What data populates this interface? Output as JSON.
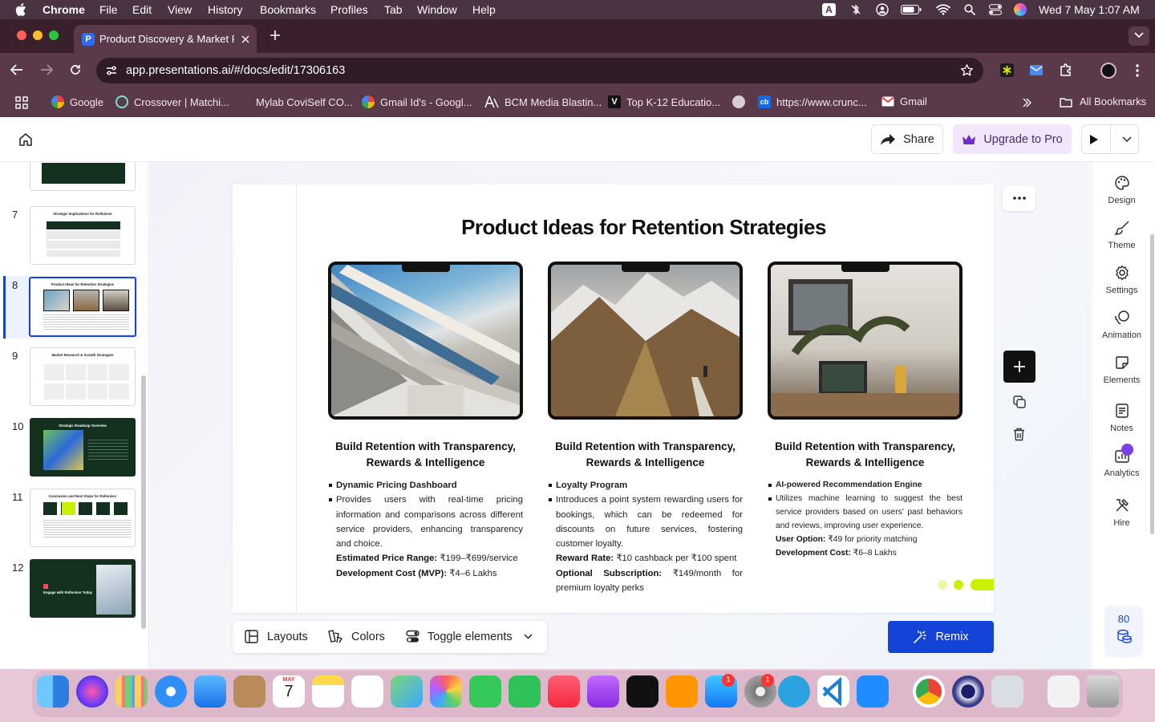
{
  "menubar": {
    "app": "Chrome",
    "items": [
      "File",
      "Edit",
      "View",
      "History",
      "Bookmarks",
      "Profiles",
      "Tab",
      "Window",
      "Help"
    ],
    "clock": "Wed 7 May  1:07 AM",
    "input_badge": "A"
  },
  "browser": {
    "tab_title": "Product Discovery & Market F",
    "url": "app.presentations.ai/#/docs/edit/17306163",
    "bookmarks": [
      "Google",
      "Crossover | Matchi...",
      "Mylab CoviSelf CO...",
      "Gmail Id's - Googl...",
      "BCM Media Blastin...",
      "Top K-12 Educatio...",
      "https://www.crunc...",
      "Gmail"
    ],
    "bookmark_badges": [
      "V",
      "cb"
    ],
    "all_bookmarks": "All Bookmarks"
  },
  "header": {
    "share": "Share",
    "upgrade": "Upgrade to Pro"
  },
  "thumbnails": {
    "items": [
      {
        "num": "7",
        "title": "Strategic Implications for Rolloniver"
      },
      {
        "num": "8",
        "title": "Product Ideas for Retention Strategies"
      },
      {
        "num": "9",
        "title": "Market Research & Growth Strategies"
      },
      {
        "num": "10",
        "title": "Strategic Roadmap Overview"
      },
      {
        "num": "11",
        "title": "Conclusion and Next Steps for Rolloniver"
      },
      {
        "num": "12",
        "title": "Engage with Rolloniver Today"
      }
    ],
    "selected": "8"
  },
  "slide": {
    "title": "Product Ideas for Retention Strategies",
    "cards": [
      {
        "heading_line1": "Build Retention with Transparency,",
        "heading_line2": "Rewards & Intelligence",
        "bullet1": "Dynamic Pricing Dashboard",
        "bullet2": "Provides users with real-time pricing information and comparisons across different service providers, enhancing transparency and choice.",
        "line1_label": "Estimated Price Range:",
        "line1_value": " ₹199–₹699/service",
        "line2_label": "Development Cost (MVP):",
        "line2_value": " ₹4–6 Lakhs"
      },
      {
        "heading_line1": "Build Retention with Transparency,",
        "heading_line2": "Rewards & Intelligence",
        "bullet1": "Loyalty Program",
        "bullet2": "Introduces a point system rewarding users for bookings, which can be redeemed for discounts on future services, fostering customer loyalty.",
        "line1_label": "Reward Rate:",
        "line1_value": " ₹10 cashback per ₹100 spent",
        "line2_label": "Optional Subscription:",
        "line2_value": " ₹149/month for premium loyalty perks"
      },
      {
        "heading_line1": "Build Retention with Transparency,",
        "heading_line2": "Rewards & Intelligence",
        "bullet1": "AI-powered Recommendation Engine",
        "bullet2": "Utilizes machine learning to suggest the best service providers based on users' past behaviors and reviews, improving user experience.",
        "line1_label": "User Option:",
        "line1_value": " ₹49 for priority matching",
        "line2_label": "Development Cost:",
        "line2_value": " ₹6–8 Lakhs"
      }
    ]
  },
  "rightrail": {
    "items": [
      "Design",
      "Theme",
      "Settings",
      "Animation",
      "Elements",
      "Notes",
      "Analytics",
      "Hire"
    ],
    "credits": "80"
  },
  "bottombar": {
    "layouts": "Layouts",
    "colors": "Colors",
    "toggle": "Toggle elements",
    "remix": "Remix"
  },
  "dock": {
    "calendar_month": "MAY",
    "calendar_day": "7",
    "appstore_badge": "1",
    "settings_badge": "1"
  },
  "colors": {
    "accent_blue": "#1443d8",
    "slide_dark_green": "#14301f",
    "lime_accent": "#c8f000",
    "upgrade_bg": "#f2e6fb"
  }
}
